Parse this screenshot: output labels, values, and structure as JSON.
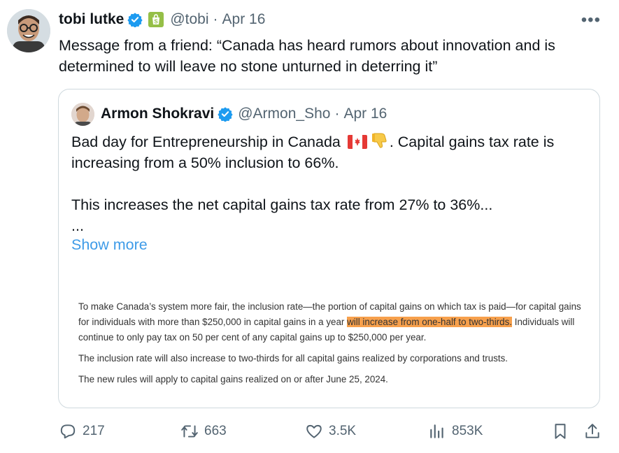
{
  "tweet": {
    "author_name": "tobi lutke",
    "handle": "@tobi",
    "separator": "·",
    "date": "Apr 16",
    "text": "Message from a friend: “Canada has heard rumors about innovation and is determined to will leave no stone unturned in deterring it”",
    "more_icon": "ellipsis-icon"
  },
  "quote": {
    "author_name": "Armon Shokravi",
    "handle": "@Armon_Sho",
    "separator": "·",
    "date": "Apr 16",
    "line1_a": "Bad day for Entrepreneurship in Canada",
    "line1_b": ". Capital gains tax rate is increasing from a 50% inclusion to 66%.",
    "line2": "This increases the net capital gains tax rate from 27% to 36%...",
    "ellipsis": "...",
    "show_more": "Show more",
    "image": {
      "para1_a": "To make Canada’s system more fair, the inclusion rate—the portion of capital gains on which tax is paid—for capital gains for individuals with more than $250,000 in capital gains in a year ",
      "para1_highlight": "will increase from one-half to two-thirds.",
      "para1_b": " Individuals will continue to only pay tax on 50 per cent of any capital gains up to $250,000 per year.",
      "para2": "The inclusion rate will also increase to two-thirds for all capital gains realized by corporations and trusts.",
      "para3": "The new rules will apply to capital gains realized on or after June 25, 2024.",
      "highlight_color": "#f7a04c"
    }
  },
  "actions": {
    "replies": "217",
    "reposts": "663",
    "likes": "3.5K",
    "views": "853K"
  },
  "colors": {
    "verified": "#1d9bf0",
    "link": "#3e9be8",
    "muted": "#536471",
    "shopify": "#95bf47"
  }
}
